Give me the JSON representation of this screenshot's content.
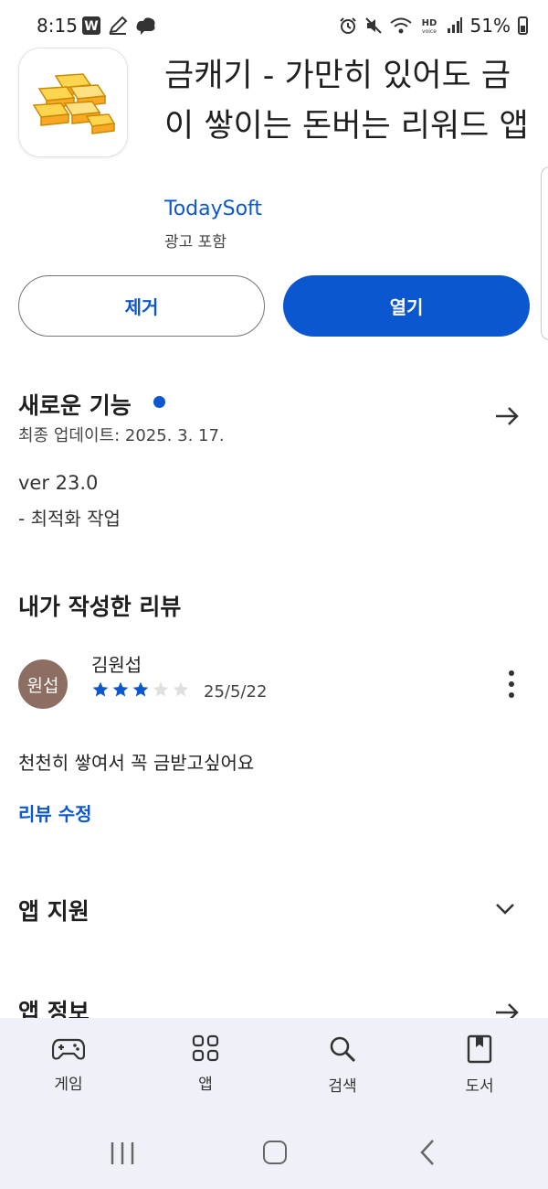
{
  "status_bar": {
    "time": "8:15",
    "battery": "51%",
    "left_icons": [
      "w-app-icon",
      "pen-icon",
      "cloud-chat-icon"
    ],
    "right_icons": [
      "alarm-icon",
      "mute-icon",
      "wifi-icon",
      "hd-voice-icon",
      "signal-icon",
      "battery-icon"
    ]
  },
  "app": {
    "title": "금캐기 - 가만히 있어도 금이 쌓이는 돈버는 리워드 앱",
    "developer": "TodaySoft",
    "ads_label": "광고 포함",
    "icon": "gold-bars-icon"
  },
  "buttons": {
    "remove": "제거",
    "open": "열기"
  },
  "whats_new": {
    "title": "새로운 기능",
    "last_updated": "최종 업데이트: 2025. 3. 17.",
    "version": "ver 23.0",
    "note": "- 최적화 작업"
  },
  "my_review": {
    "section_title": "내가 작성한 리뷰",
    "avatar_text": "원섭",
    "reviewer": "김원섭",
    "rating": 3,
    "rating_max": 5,
    "date": "25/5/22",
    "text": "천천히 쌓여서 꼭 금받고싶어요",
    "edit_label": "리뷰 수정"
  },
  "app_support": {
    "title": "앱 지원"
  },
  "app_info": {
    "title": "앱 정보"
  },
  "bottom_nav": [
    {
      "label": "게임",
      "icon": "gamepad-icon"
    },
    {
      "label": "앱",
      "icon": "apps-grid-icon"
    },
    {
      "label": "검색",
      "icon": "search-icon"
    },
    {
      "label": "도서",
      "icon": "book-icon"
    }
  ],
  "colors": {
    "accent": "#0b57d0",
    "star_filled": "#0b57d0",
    "star_empty": "#e0e0e0",
    "avatar_bg": "#8d6e63",
    "nav_bg": "#eef2f8"
  }
}
